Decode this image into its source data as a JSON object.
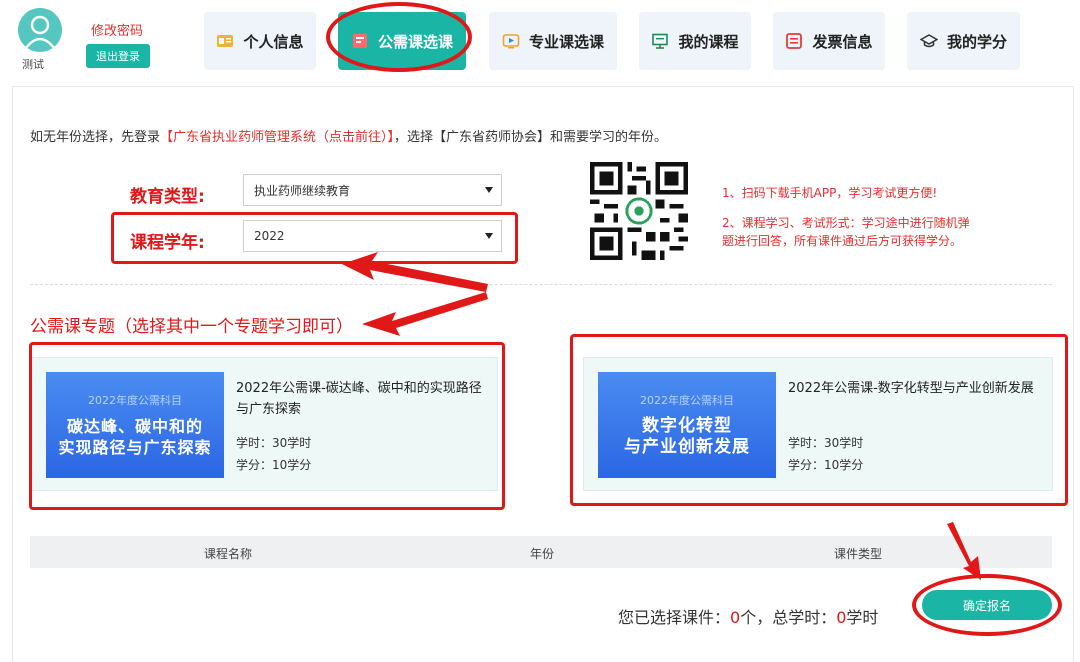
{
  "header": {
    "username": "测试",
    "change_password": "修改密码",
    "logout": "退出登录",
    "tabs": [
      {
        "label": "个人信息",
        "icon": "id-card-icon"
      },
      {
        "label": "公需课选课",
        "icon": "course-book-icon",
        "active": true
      },
      {
        "label": "专业课选课",
        "icon": "video-play-icon"
      },
      {
        "label": "我的课程",
        "icon": "screen-icon"
      },
      {
        "label": "发票信息",
        "icon": "invoice-icon"
      },
      {
        "label": "我的学分",
        "icon": "graduation-cap-icon"
      }
    ]
  },
  "intro": {
    "prefix": "如无年份选择，先登录",
    "link": "【广东省执业药师管理系统（点击前往）】",
    "suffix": "，选择【广东省药师协会】和需要学习的年份。"
  },
  "form": {
    "edu_type_label": "教育类型:",
    "edu_type_value": "执业药师继续教育",
    "year_label": "课程学年:",
    "year_value": "2022"
  },
  "qr_notes": {
    "line1": "1、扫码下载手机APP，学习考试更方便!",
    "line2": "2、课程学习、考试形式：学习途中进行随机弹",
    "line3": "题进行回答，所有课件通过后方可获得学分。"
  },
  "section": {
    "title": "公需课专题（选择其中一个专题学习即可）"
  },
  "courses": [
    {
      "cover_tag": "2022年度公需科目",
      "cover_line1": "碳达峰、碳中和的",
      "cover_line2": "实现路径与广东探索",
      "title_line1": "2022年公需课-碳达峰、碳中和的实现路径",
      "title_line2": "与广东探索",
      "hours": "学时：30学时",
      "credits": "学分：10学分"
    },
    {
      "cover_tag": "2022年度公需科目",
      "cover_line1": "数字化转型",
      "cover_line2": "与产业创新发展",
      "title_line1": "2022年公需课-数字化转型与产业创新发展",
      "title_line2": "",
      "hours": "学时：30学时",
      "credits": "学分：10学分"
    }
  ],
  "table": {
    "col_name": "课程名称",
    "col_year": "年份",
    "col_type": "课件类型"
  },
  "summary": {
    "prefix": "您已选择课件：",
    "count": "0",
    "mid": "个，总学时：",
    "hours": "0",
    "suffix": "学时"
  },
  "confirm_button": "确定报名",
  "colors": {
    "accent": "#1bb5a6",
    "annotation_red": "#e01818",
    "tab_bg": "#eef4f9",
    "cover_blue": "#2b66e4"
  }
}
